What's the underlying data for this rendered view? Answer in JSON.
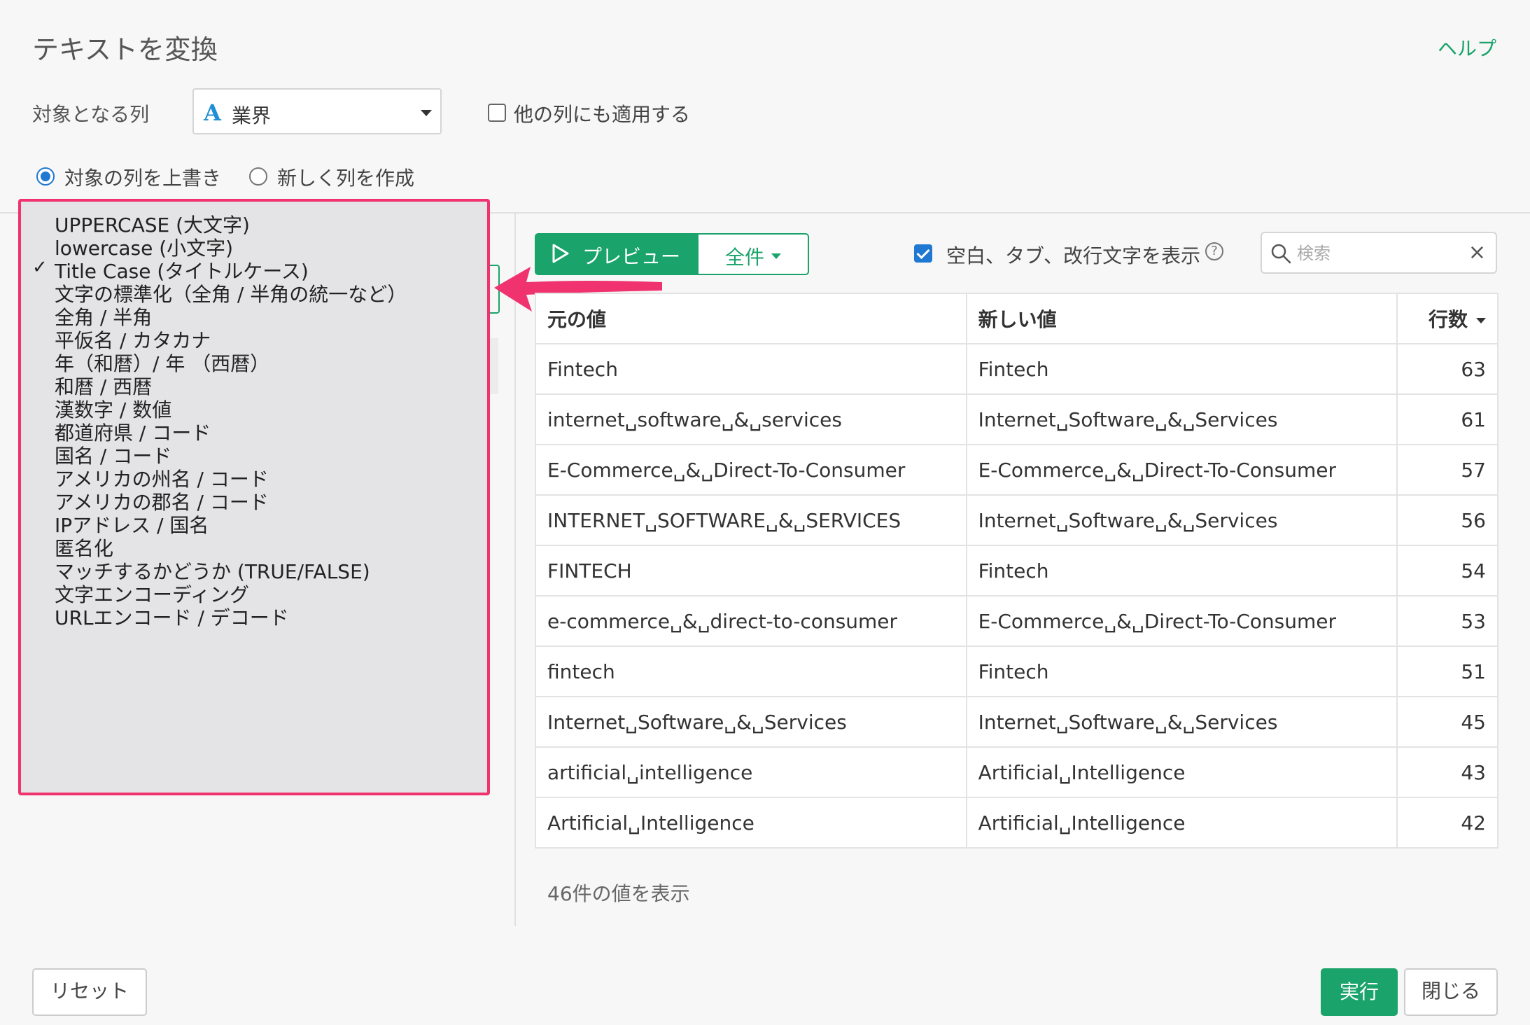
{
  "dialog": {
    "title": "テキストを変換",
    "help": "ヘルプ"
  },
  "target_column": {
    "label": "対象となる列",
    "type_icon": "A",
    "value": "業界"
  },
  "apply_other": {
    "label": "他の列にも適用する",
    "checked": false
  },
  "mode": {
    "overwrite": {
      "label": "対象の列を上書き",
      "selected": true
    },
    "new_column": {
      "label": "新しく列を作成",
      "selected": false
    }
  },
  "dropdown": {
    "items": [
      "UPPERCASE (大文字)",
      "lowercase (小文字)",
      "Title Case (タイトルケース)",
      "文字の標準化（全角 / 半角の統一など）",
      "全角 / 半角",
      "平仮名 / カタカナ",
      "年（和暦）/ 年 （西暦）",
      "和暦 / 西暦",
      "漢数字 / 数値",
      "都道府県 / コード",
      "国名 / コード",
      "アメリカの州名 / コード",
      "アメリカの郡名 / コード",
      "IPアドレス / 国名",
      "匿名化",
      "マッチするかどうか (TRUE/FALSE)",
      "文字エンコーディング",
      "URLエンコード / デコード"
    ],
    "selected_index": 2,
    "check_mark": "✓",
    "highlight_color": "#f0336f"
  },
  "toolbar": {
    "preview_label": "プレビュー",
    "all_label": "全件",
    "show_whitespace_label": "空白、タブ、改行文字を表示",
    "show_whitespace_checked": true,
    "help_icon": "?",
    "search_placeholder": "検索",
    "clear_icon": "×"
  },
  "table": {
    "headers": {
      "original": "元の値",
      "new": "新しい値",
      "count": "行数"
    },
    "rows": [
      {
        "original": "Fintech",
        "new": "Fintech",
        "count": "63"
      },
      {
        "original": "internet␣software␣&␣services",
        "new": "Internet␣Software␣&␣Services",
        "count": "61"
      },
      {
        "original": "E-Commerce␣&␣Direct-To-Consumer",
        "new": "E-Commerce␣&␣Direct-To-Consumer",
        "count": "57"
      },
      {
        "original": "INTERNET␣SOFTWARE␣&␣SERVICES",
        "new": "Internet␣Software␣&␣Services",
        "count": "56"
      },
      {
        "original": "FINTECH",
        "new": "Fintech",
        "count": "54"
      },
      {
        "original": "e-commerce␣&␣direct-to-consumer",
        "new": "E-Commerce␣&␣Direct-To-Consumer",
        "count": "53"
      },
      {
        "original": "fintech",
        "new": "Fintech",
        "count": "51"
      },
      {
        "original": "Internet␣Software␣&␣Services",
        "new": "Internet␣Software␣&␣Services",
        "count": "45"
      },
      {
        "original": "artificial␣intelligence",
        "new": "Artificial␣Intelligence",
        "count": "43"
      },
      {
        "original": "Artificial␣Intelligence",
        "new": "Artificial␣Intelligence",
        "count": "42"
      }
    ],
    "summary": "46件の値を表示"
  },
  "footer": {
    "reset": "リセット",
    "run": "実行",
    "close": "閉じる"
  },
  "colors": {
    "accent": "#1aa36a",
    "checkbox": "#1f78d1",
    "highlight": "#f0336f"
  }
}
